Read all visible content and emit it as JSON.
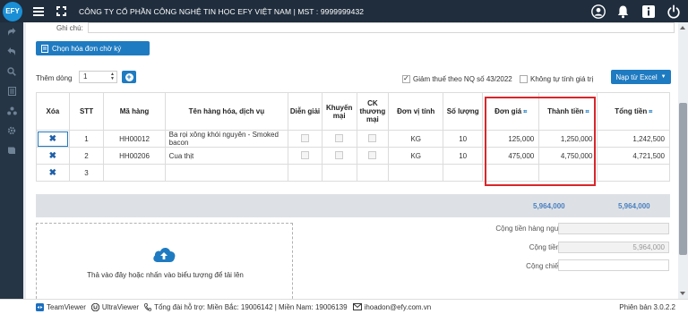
{
  "topbar": {
    "logo_text": "EFY",
    "company": "CÔNG TY CỔ PHẦN CÔNG NGHỆ TIN HỌC EFY VIỆT NAM | MST : 9999999432",
    "icons": [
      "user-icon",
      "bell-icon",
      "info-icon",
      "power-icon"
    ]
  },
  "sidebar": {
    "icons": [
      "share-icon",
      "back-icon",
      "search-icon",
      "document-icon",
      "network-icon",
      "gear-icon",
      "book-icon"
    ]
  },
  "form": {
    "ghichu_label": "Ghi chú:",
    "ghichu_value": "",
    "chon_button": "Chọn hóa đơn chờ ký",
    "themdong_label": "Thêm dòng",
    "themdong_value": "1",
    "giam_thue_label": "Giảm thuế theo NQ số 43/2022",
    "giam_thue_checked": true,
    "khong_tu_tinh_label": "Không tự tính giá trị",
    "khong_tu_tinh_checked": false,
    "nap_excel_button": "Nạp từ Excel"
  },
  "table": {
    "headers": {
      "xoa": "Xóa",
      "stt": "STT",
      "ma_hang": "Mã hàng",
      "ten_hang": "Tên hàng hóa, dịch vụ",
      "dien_giai": "Diễn giải",
      "khuyen_mai": "Khuyến mại",
      "ck_thuong_mai": "CK thương mại",
      "don_vi_tinh": "Đơn vị tính",
      "so_luong": "Số lượng",
      "don_gia": "Đơn giá",
      "thanh_tien": "Thành tiền",
      "tong_tien": "Tổng tiền"
    },
    "rows": [
      {
        "stt": "1",
        "ma_hang": "HH00012",
        "ten_hang": "Ba rọi xông khói nguyên - Smoked bacon",
        "dvt": "KG",
        "so_luong": "10",
        "don_gia": "125,000",
        "thanh_tien": "1,250,000",
        "tong_tien": "1,242,500"
      },
      {
        "stt": "2",
        "ma_hang": "HH00206",
        "ten_hang": "Cua thịt",
        "dvt": "KG",
        "so_luong": "10",
        "don_gia": "475,000",
        "thanh_tien": "4,750,000",
        "tong_tien": "4,721,500"
      },
      {
        "stt": "3",
        "ma_hang": "",
        "ten_hang": "",
        "dvt": "",
        "so_luong": "",
        "don_gia": "",
        "thanh_tien": "",
        "tong_tien": ""
      }
    ],
    "totals": {
      "thanh_tien": "5,964,000",
      "tong_tien": "5,964,000"
    }
  },
  "upload": {
    "text": "Thả vào đây hoặc nhấn vào biểu tượng để tải lên"
  },
  "summary": {
    "nguyen_te_label": "Cộng tiền hàng nguyên tệ",
    "nguyen_te_value": "",
    "tien_hang_label": "Cộng tiền hàng",
    "tien_hang_value": "5,964,000",
    "chiet_khau_label": "Cộng chiết khấu",
    "chiet_khau_value": ""
  },
  "footer": {
    "teamviewer": "TeamViewer",
    "ultraviewer": "UltraViewer",
    "hotline": "Tổng đài hỗ trợ: Miền Bắc: 19006142 | Miền Nam: 19006139",
    "email": "ihoadon@efy.com.vn",
    "version": "Phiên bản 3.0.2.2"
  }
}
